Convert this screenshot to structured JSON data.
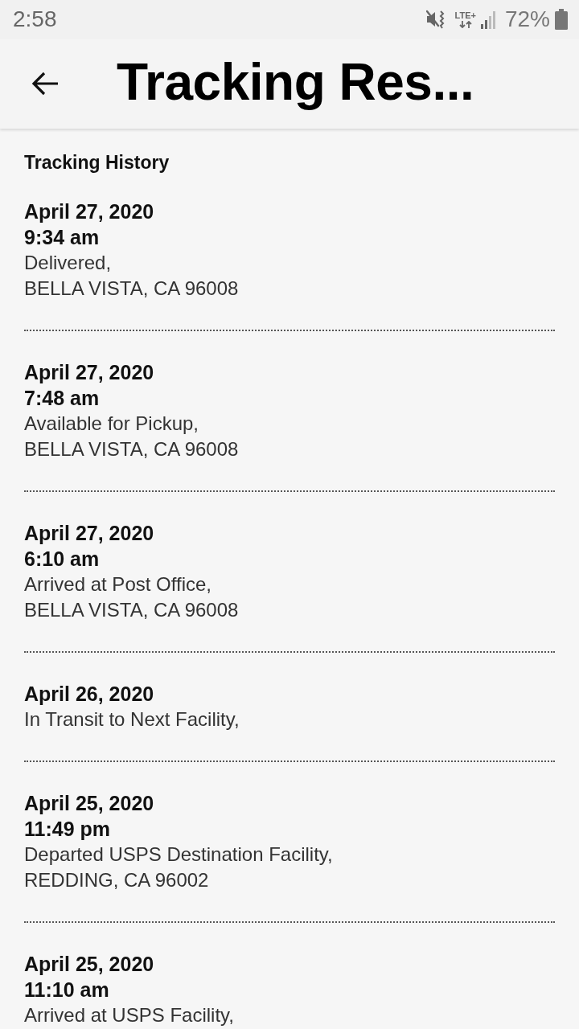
{
  "status_bar": {
    "time": "2:58",
    "network": "LTE+",
    "battery": "72%"
  },
  "app_bar": {
    "title": "Tracking Res..."
  },
  "section_title": "Tracking History",
  "events": [
    {
      "date": "April 27, 2020",
      "time": "9:34 am",
      "status": "Delivered,",
      "location": "BELLA VISTA, CA 96008"
    },
    {
      "date": "April 27, 2020",
      "time": "7:48 am",
      "status": "Available for Pickup,",
      "location": "BELLA VISTA, CA 96008"
    },
    {
      "date": "April 27, 2020",
      "time": "6:10 am",
      "status": "Arrived at Post Office,",
      "location": "BELLA VISTA, CA 96008"
    },
    {
      "date": "April 26, 2020",
      "status": "In Transit to Next Facility,"
    },
    {
      "date": "April 25, 2020",
      "time": "11:49 pm",
      "status": "Departed USPS Destination Facility,",
      "location": "REDDING, CA 96002"
    },
    {
      "date": "April 25, 2020",
      "time": "11:10 am",
      "status": "Arrived at USPS Facility,"
    }
  ]
}
